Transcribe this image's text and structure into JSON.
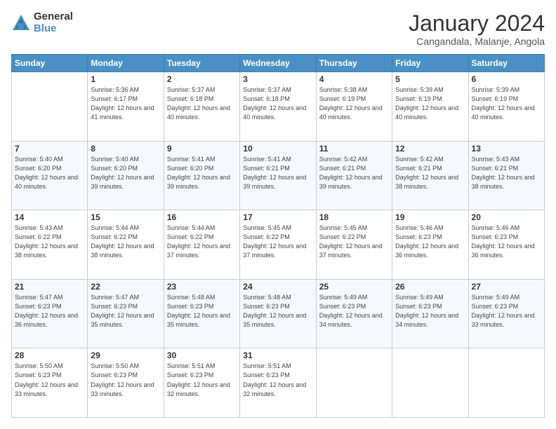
{
  "logo": {
    "general": "General",
    "blue": "Blue"
  },
  "title": "January 2024",
  "subtitle": "Cangandala, Malanje, Angola",
  "days_of_week": [
    "Sunday",
    "Monday",
    "Tuesday",
    "Wednesday",
    "Thursday",
    "Friday",
    "Saturday"
  ],
  "weeks": [
    [
      {
        "day": "",
        "sunrise": "",
        "sunset": "",
        "daylight": ""
      },
      {
        "day": "1",
        "sunrise": "Sunrise: 5:36 AM",
        "sunset": "Sunset: 6:17 PM",
        "daylight": "Daylight: 12 hours and 41 minutes."
      },
      {
        "day": "2",
        "sunrise": "Sunrise: 5:37 AM",
        "sunset": "Sunset: 6:18 PM",
        "daylight": "Daylight: 12 hours and 40 minutes."
      },
      {
        "day": "3",
        "sunrise": "Sunrise: 5:37 AM",
        "sunset": "Sunset: 6:18 PM",
        "daylight": "Daylight: 12 hours and 40 minutes."
      },
      {
        "day": "4",
        "sunrise": "Sunrise: 5:38 AM",
        "sunset": "Sunset: 6:19 PM",
        "daylight": "Daylight: 12 hours and 40 minutes."
      },
      {
        "day": "5",
        "sunrise": "Sunrise: 5:39 AM",
        "sunset": "Sunset: 6:19 PM",
        "daylight": "Daylight: 12 hours and 40 minutes."
      },
      {
        "day": "6",
        "sunrise": "Sunrise: 5:39 AM",
        "sunset": "Sunset: 6:19 PM",
        "daylight": "Daylight: 12 hours and 40 minutes."
      }
    ],
    [
      {
        "day": "7",
        "sunrise": "Sunrise: 5:40 AM",
        "sunset": "Sunset: 6:20 PM",
        "daylight": "Daylight: 12 hours and 40 minutes."
      },
      {
        "day": "8",
        "sunrise": "Sunrise: 5:40 AM",
        "sunset": "Sunset: 6:20 PM",
        "daylight": "Daylight: 12 hours and 39 minutes."
      },
      {
        "day": "9",
        "sunrise": "Sunrise: 5:41 AM",
        "sunset": "Sunset: 6:20 PM",
        "daylight": "Daylight: 12 hours and 39 minutes."
      },
      {
        "day": "10",
        "sunrise": "Sunrise: 5:41 AM",
        "sunset": "Sunset: 6:21 PM",
        "daylight": "Daylight: 12 hours and 39 minutes."
      },
      {
        "day": "11",
        "sunrise": "Sunrise: 5:42 AM",
        "sunset": "Sunset: 6:21 PM",
        "daylight": "Daylight: 12 hours and 39 minutes."
      },
      {
        "day": "12",
        "sunrise": "Sunrise: 5:42 AM",
        "sunset": "Sunset: 6:21 PM",
        "daylight": "Daylight: 12 hours and 38 minutes."
      },
      {
        "day": "13",
        "sunrise": "Sunrise: 5:43 AM",
        "sunset": "Sunset: 6:21 PM",
        "daylight": "Daylight: 12 hours and 38 minutes."
      }
    ],
    [
      {
        "day": "14",
        "sunrise": "Sunrise: 5:43 AM",
        "sunset": "Sunset: 6:22 PM",
        "daylight": "Daylight: 12 hours and 38 minutes."
      },
      {
        "day": "15",
        "sunrise": "Sunrise: 5:44 AM",
        "sunset": "Sunset: 6:22 PM",
        "daylight": "Daylight: 12 hours and 38 minutes."
      },
      {
        "day": "16",
        "sunrise": "Sunrise: 5:44 AM",
        "sunset": "Sunset: 6:22 PM",
        "daylight": "Daylight: 12 hours and 37 minutes."
      },
      {
        "day": "17",
        "sunrise": "Sunrise: 5:45 AM",
        "sunset": "Sunset: 6:22 PM",
        "daylight": "Daylight: 12 hours and 37 minutes."
      },
      {
        "day": "18",
        "sunrise": "Sunrise: 5:45 AM",
        "sunset": "Sunset: 6:22 PM",
        "daylight": "Daylight: 12 hours and 37 minutes."
      },
      {
        "day": "19",
        "sunrise": "Sunrise: 5:46 AM",
        "sunset": "Sunset: 6:23 PM",
        "daylight": "Daylight: 12 hours and 36 minutes."
      },
      {
        "day": "20",
        "sunrise": "Sunrise: 5:46 AM",
        "sunset": "Sunset: 6:23 PM",
        "daylight": "Daylight: 12 hours and 36 minutes."
      }
    ],
    [
      {
        "day": "21",
        "sunrise": "Sunrise: 5:47 AM",
        "sunset": "Sunset: 6:23 PM",
        "daylight": "Daylight: 12 hours and 36 minutes."
      },
      {
        "day": "22",
        "sunrise": "Sunrise: 5:47 AM",
        "sunset": "Sunset: 6:23 PM",
        "daylight": "Daylight: 12 hours and 35 minutes."
      },
      {
        "day": "23",
        "sunrise": "Sunrise: 5:48 AM",
        "sunset": "Sunset: 6:23 PM",
        "daylight": "Daylight: 12 hours and 35 minutes."
      },
      {
        "day": "24",
        "sunrise": "Sunrise: 5:48 AM",
        "sunset": "Sunset: 6:23 PM",
        "daylight": "Daylight: 12 hours and 35 minutes."
      },
      {
        "day": "25",
        "sunrise": "Sunrise: 5:49 AM",
        "sunset": "Sunset: 6:23 PM",
        "daylight": "Daylight: 12 hours and 34 minutes."
      },
      {
        "day": "26",
        "sunrise": "Sunrise: 5:49 AM",
        "sunset": "Sunset: 6:23 PM",
        "daylight": "Daylight: 12 hours and 34 minutes."
      },
      {
        "day": "27",
        "sunrise": "Sunrise: 5:49 AM",
        "sunset": "Sunset: 6:23 PM",
        "daylight": "Daylight: 12 hours and 33 minutes."
      }
    ],
    [
      {
        "day": "28",
        "sunrise": "Sunrise: 5:50 AM",
        "sunset": "Sunset: 6:23 PM",
        "daylight": "Daylight: 12 hours and 33 minutes."
      },
      {
        "day": "29",
        "sunrise": "Sunrise: 5:50 AM",
        "sunset": "Sunset: 6:23 PM",
        "daylight": "Daylight: 12 hours and 33 minutes."
      },
      {
        "day": "30",
        "sunrise": "Sunrise: 5:51 AM",
        "sunset": "Sunset: 6:23 PM",
        "daylight": "Daylight: 12 hours and 32 minutes."
      },
      {
        "day": "31",
        "sunrise": "Sunrise: 5:51 AM",
        "sunset": "Sunset: 6:23 PM",
        "daylight": "Daylight: 12 hours and 32 minutes."
      },
      {
        "day": "",
        "sunrise": "",
        "sunset": "",
        "daylight": ""
      },
      {
        "day": "",
        "sunrise": "",
        "sunset": "",
        "daylight": ""
      },
      {
        "day": "",
        "sunrise": "",
        "sunset": "",
        "daylight": ""
      }
    ]
  ]
}
